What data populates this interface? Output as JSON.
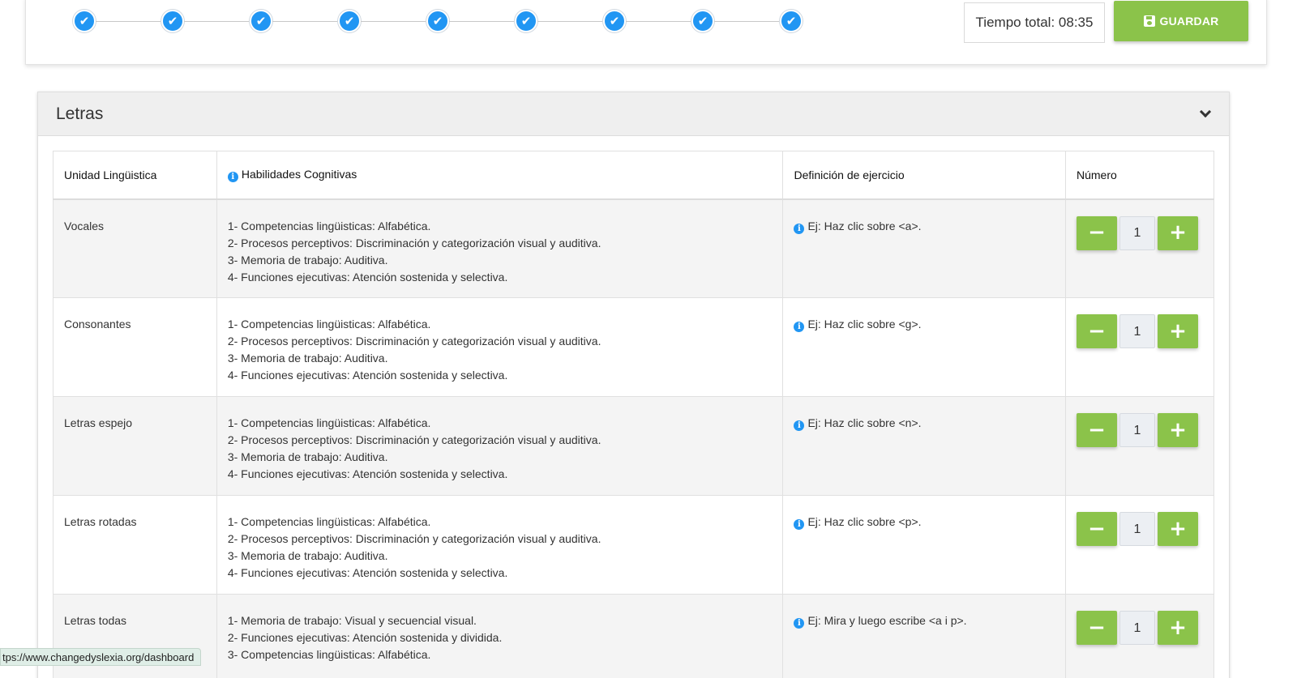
{
  "steps": {
    "count": 9,
    "checkmark": "✔"
  },
  "timer": {
    "text": "Tiempo total: 08:35"
  },
  "save_button": {
    "label": "GUARDAR",
    "icon": "floppy-disk-icon"
  },
  "panel": {
    "title": "Letras",
    "toggle_icon": "chevron-down-icon"
  },
  "table": {
    "headers": [
      "Unidad Lingüistica",
      "Habilidades Cognitivas",
      "Definición de ejercicio",
      "Número"
    ],
    "rows": [
      {
        "unit": "Vocales",
        "skills": [
          "1- Competencias lingüisticas: Alfabética.",
          "2- Procesos perceptivos: Discriminación y categorización visual y auditiva.",
          "3- Memoria de trabajo: Auditiva.",
          "4- Funciones ejecutivas: Atención sostenida y selectiva."
        ],
        "definition": "Ej: Haz clic sobre <a>.",
        "number": "1"
      },
      {
        "unit": "Consonantes",
        "skills": [
          "1- Competencias lingüisticas: Alfabética.",
          "2- Procesos perceptivos: Discriminación y categorización visual y auditiva.",
          "3- Memoria de trabajo: Auditiva.",
          "4- Funciones ejecutivas: Atención sostenida y selectiva."
        ],
        "definition": "Ej: Haz clic sobre <g>.",
        "number": "1"
      },
      {
        "unit": "Letras espejo",
        "skills": [
          "1- Competencias lingüisticas: Alfabética.",
          "2- Procesos perceptivos: Discriminación y categorización visual y auditiva.",
          "3- Memoria de trabajo: Auditiva.",
          "4- Funciones ejecutivas: Atención sostenida y selectiva."
        ],
        "definition": "Ej: Haz clic sobre <n>.",
        "number": "1"
      },
      {
        "unit": "Letras rotadas",
        "skills": [
          "1- Competencias lingüisticas: Alfabética.",
          "2- Procesos perceptivos: Discriminación y categorización visual y auditiva.",
          "3- Memoria de trabajo: Auditiva.",
          "4- Funciones ejecutivas: Atención sostenida y selectiva."
        ],
        "definition": "Ej: Haz clic sobre <p>.",
        "number": "1"
      },
      {
        "unit": "Letras todas",
        "skills": [
          "1- Memoria de trabajo: Visual y secuencial visual.",
          "2- Funciones ejecutivas: Atención sostenida y dividida.",
          "3- Competencias lingüisticas: Alfabética."
        ],
        "definition": "Ej: Mira y luego escribe <a i p>.",
        "number": "1"
      }
    ],
    "minus_symbol": "−",
    "plus_symbol": "+"
  },
  "status_bar": {
    "url": "tps://www.changedyslexia.org/dashboard"
  },
  "colors": {
    "accent_green": "#8bc34a",
    "step_blue": "#2196f3"
  }
}
